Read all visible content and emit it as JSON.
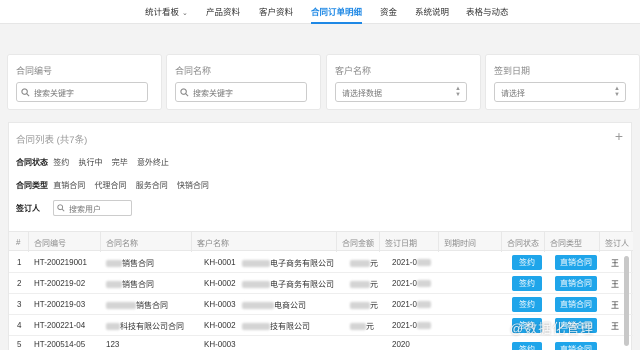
{
  "nav": {
    "items": [
      "统计看板",
      "产品资料",
      "客户资料",
      "合同订单明细",
      "资金",
      "系统说明",
      "表格与动态"
    ],
    "active_index": 3,
    "accent": "#1e88e5"
  },
  "filters": [
    {
      "label": "合同编号",
      "placeholder": "搜索关键字",
      "type": "search"
    },
    {
      "label": "合同名称",
      "placeholder": "搜索关键字",
      "type": "search"
    },
    {
      "label": "客户名称",
      "placeholder": "请选择数据",
      "type": "select"
    },
    {
      "label": "签到日期",
      "placeholder": "请选择",
      "type": "select"
    }
  ],
  "panel": {
    "title": "合同列表 (共7条)",
    "plus": "+",
    "status_label": "合同状态",
    "status_options": [
      "签约",
      "执行中",
      "完毕",
      "意外终止"
    ],
    "type_label": "合同类型",
    "type_options": [
      "直销合同",
      "代理合同",
      "服务合同",
      "快销合同"
    ],
    "signer_label": "签订人",
    "signer_placeholder": "搜索用户"
  },
  "table": {
    "headers": [
      "#",
      "合同编号",
      "合同名称",
      "客户名称",
      "合同金额",
      "签订日期",
      "到期时间",
      "合同状态",
      "合同类型",
      "签订人"
    ],
    "rows": [
      {
        "idx": "1",
        "code": "HT-200219001",
        "name": "销售合同",
        "cust_code": "KH-0001",
        "cust": "电子商务有限公司",
        "amount": "元",
        "date": "2021-0",
        "status": "签约",
        "type": "直销合同",
        "signer": "王"
      },
      {
        "idx": "2",
        "code": "HT-200219-02",
        "name": "销售合同",
        "cust_code": "KH-0002",
        "cust": "电子商务有限公司",
        "amount": "元",
        "date": "2021-0",
        "status": "签约",
        "type": "直销合同",
        "signer": "王"
      },
      {
        "idx": "3",
        "code": "HT-200219-03",
        "name": "销售合同",
        "cust_code": "KH-0003",
        "cust": "电商公司",
        "amount": "元",
        "date": "2021-0",
        "status": "签约",
        "type": "直销合同",
        "signer": "王"
      },
      {
        "idx": "4",
        "code": "HT-200221-04",
        "name": "科技有限公司合同",
        "cust_code": "KH-0002",
        "cust": "技有限公司",
        "amount": "元",
        "date": "2021-0",
        "status": "签约",
        "type": "直销合同",
        "signer": "王"
      },
      {
        "idx": "5",
        "code": "HT-200514-05",
        "name": "123",
        "cust_code": "KH-0003",
        "cust": "",
        "amount": "",
        "date": "2020",
        "status": "签约",
        "type": "直销合同",
        "signer": ""
      }
    ],
    "button_color": "#1fa5ea"
  },
  "watermark": "@数据化管理"
}
